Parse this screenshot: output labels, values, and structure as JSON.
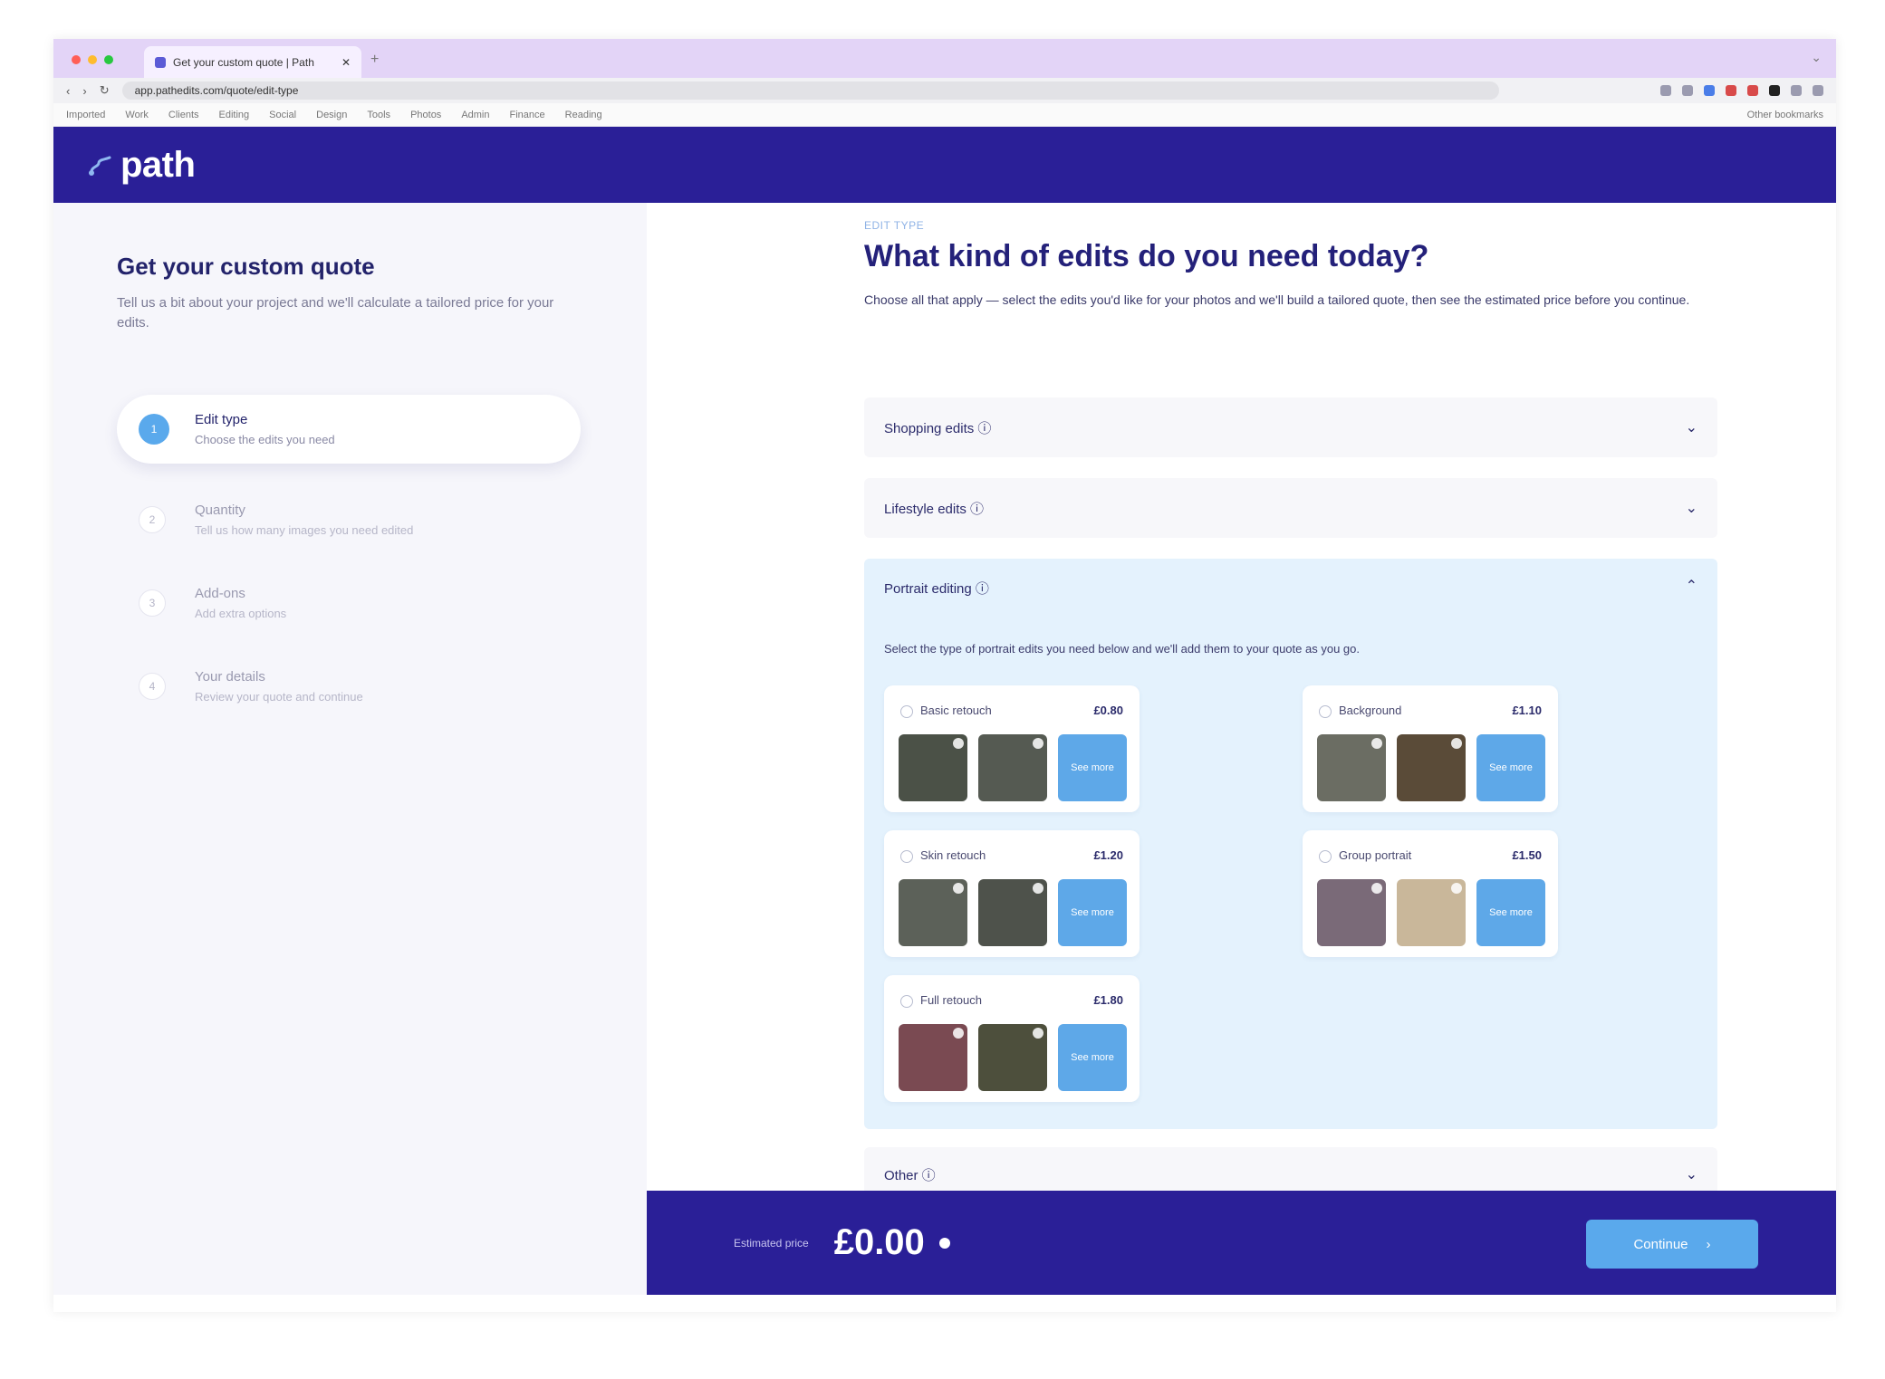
{
  "browser": {
    "tab_title": "Get your custom quote | Path",
    "tab_close": "✕",
    "new_tab": "+",
    "window_control": "⌄",
    "url": "app.pathedits.com/quote/edit-type",
    "nav_back": "‹",
    "nav_forward": "›",
    "reload": "↻",
    "bookmarks": [
      "Imported",
      "Work",
      "Clients",
      "Editing",
      "Social",
      "Design",
      "Tools",
      "Photos",
      "Admin",
      "Finance",
      "Reading",
      "Other bookmarks"
    ],
    "traffic_colors": [
      "#ff5f57",
      "#febc2e",
      "#28c840"
    ]
  },
  "header": {
    "logo_text": "path"
  },
  "sidebar": {
    "title": "Get your custom quote",
    "subtitle": "Tell us a bit about your project and we'll calculate a tailored price for your edits.",
    "steps": [
      {
        "num": "1",
        "title": "Edit type",
        "desc": "Choose the edits you need"
      },
      {
        "num": "2",
        "title": "Quantity",
        "desc": "Tell us how many images you need edited"
      },
      {
        "num": "3",
        "title": "Add-ons",
        "desc": "Add extra options"
      },
      {
        "num": "4",
        "title": "Your details",
        "desc": "Review your quote and continue"
      }
    ]
  },
  "main": {
    "eyebrow": "EDIT TYPE",
    "question": "What kind of edits do you need today?",
    "description": "Choose all that apply — select the edits you'd like for your photos and we'll build a tailored quote, then see the estimated price before you continue.",
    "accordions": [
      {
        "label": "Shopping edits ⓘ",
        "chevron": "⌄"
      },
      {
        "label": "Lifestyle edits ⓘ",
        "chevron": "⌄"
      },
      {
        "label": "Portrait editing ⓘ",
        "chevron": "⌃"
      },
      {
        "label": "Other ⓘ",
        "chevron": "⌄"
      }
    ],
    "open_section": {
      "description": "Select the type of portrait edits you need below and we'll add them to your quote as you go.",
      "cards": [
        {
          "name": "Basic retouch",
          "price": "£0.80",
          "more": "See more"
        },
        {
          "name": "Background",
          "price": "£1.10",
          "more": "See more"
        },
        {
          "name": "Skin retouch",
          "price": "£1.20",
          "more": "See more"
        },
        {
          "name": "Group portrait",
          "price": "£1.50",
          "more": "See more"
        },
        {
          "name": "Full retouch",
          "price": "£1.80",
          "more": "See more"
        }
      ]
    }
  },
  "footer": {
    "estimated_label": "Estimated price",
    "total": "£0.00",
    "continue_label": "Continue",
    "continue_arrow": "›"
  },
  "colors": {
    "brand": "#2a1f97",
    "accent": "#5aa9ec",
    "open_section_bg": "#e4f2fd"
  }
}
